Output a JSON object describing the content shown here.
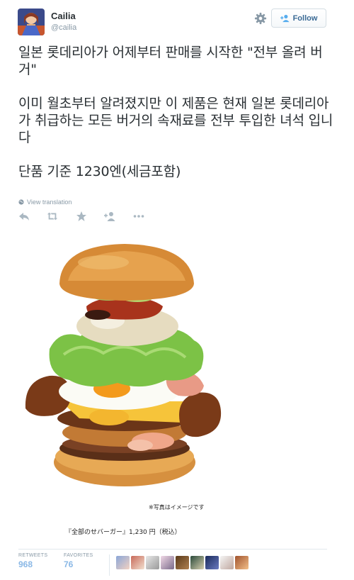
{
  "user": {
    "name": "Cailia",
    "handle": "@cailia"
  },
  "header": {
    "follow_label": "Follow",
    "settings_icon": "gear-icon",
    "follow_icon": "add-user-icon"
  },
  "tweet": {
    "paragraphs": [
      "일본 롯데리아가 어제부터 판매를 시작한 \"전부 올려 버거\"",
      "이미 월초부터 알려졌지만 이 제품은 현재 일본 롯데리아가 취급하는 모든 버거의 속재료를 전부 투입한 녀석 입니다",
      "단품 기준 1230엔(세금포함)"
    ],
    "translate_label": "View translation"
  },
  "actions": [
    "reply-icon",
    "retweet-icon",
    "favorite-icon",
    "follow-icon",
    "more-icon"
  ],
  "photo": {
    "note": "※写真はイメージです",
    "caption": "『全部のせバーガー』1,230 円（税込）"
  },
  "stats": {
    "retweets_label": "RETWEETS",
    "retweets_value": "968",
    "favorites_label": "FAVORITES",
    "favorites_value": "76"
  },
  "colors": {
    "link": "#3a6a95",
    "stat_value": "#8ab8e6",
    "muted": "#8899a6"
  }
}
